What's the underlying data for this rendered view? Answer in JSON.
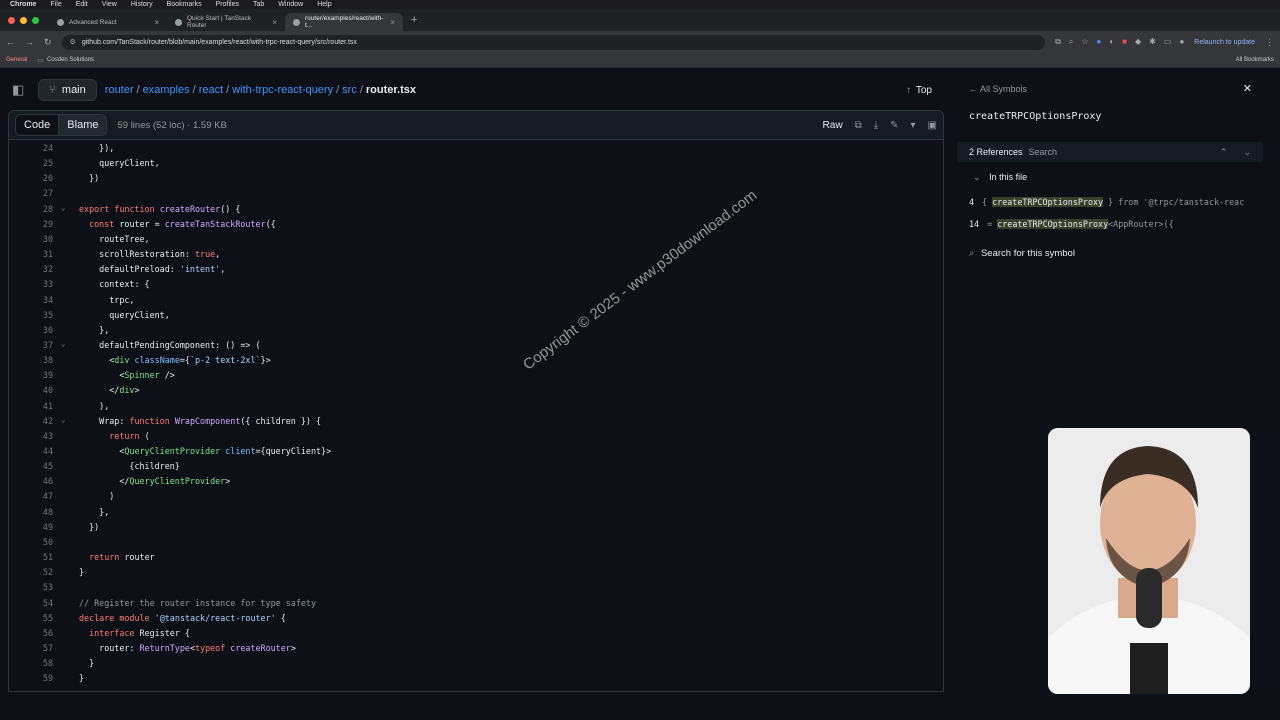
{
  "menubar": [
    "Chrome",
    "File",
    "Edit",
    "View",
    "History",
    "Bookmarks",
    "Profiles",
    "Tab",
    "Window",
    "Help"
  ],
  "tabs": [
    {
      "title": "Advanced React",
      "active": false
    },
    {
      "title": "Quick Start | TanStack Router",
      "active": false
    },
    {
      "title": "router/examples/react/with-t...",
      "active": true
    }
  ],
  "address": {
    "url": "github.com/TanStack/router/blob/main/examples/react/with-trpc-react-query/src/router.tsx",
    "relaunch": "Relaunch to update"
  },
  "bookmarks": {
    "left": [
      "General",
      "Cosden Solutions"
    ],
    "right": "All Bookmarks"
  },
  "header": {
    "branch": "main",
    "crumbs": [
      "router",
      "examples",
      "react",
      "with-trpc-react-query",
      "src"
    ],
    "file": "router.tsx",
    "top": "Top"
  },
  "filebar": {
    "code": "Code",
    "blame": "Blame",
    "meta": "59 lines (52 loc) · 1.59 KB",
    "raw": "Raw"
  },
  "code": [
    {
      "n": 24,
      "t": "    }),"
    },
    {
      "n": 25,
      "t": "    queryClient,"
    },
    {
      "n": 26,
      "t": "  })"
    },
    {
      "n": 27,
      "t": ""
    },
    {
      "n": 28,
      "t": "export function createRouter() {",
      "fold": true
    },
    {
      "n": 29,
      "t": "  const router = createTanStackRouter({"
    },
    {
      "n": 30,
      "t": "    routeTree,"
    },
    {
      "n": 31,
      "t": "    scrollRestoration: true,"
    },
    {
      "n": 32,
      "t": "    defaultPreload: 'intent',"
    },
    {
      "n": 33,
      "t": "    context: {"
    },
    {
      "n": 34,
      "t": "      trpc,"
    },
    {
      "n": 35,
      "t": "      queryClient,"
    },
    {
      "n": 36,
      "t": "    },"
    },
    {
      "n": 37,
      "t": "    defaultPendingComponent: () => (",
      "fold": true
    },
    {
      "n": 38,
      "t": "      <div className={`p-2 text-2xl`}>"
    },
    {
      "n": 39,
      "t": "        <Spinner />"
    },
    {
      "n": 40,
      "t": "      </div>"
    },
    {
      "n": 41,
      "t": "    ),"
    },
    {
      "n": 42,
      "t": "    Wrap: function WrapComponent({ children }) {",
      "fold": true
    },
    {
      "n": 43,
      "t": "      return ("
    },
    {
      "n": 44,
      "t": "        <QueryClientProvider client={queryClient}>"
    },
    {
      "n": 45,
      "t": "          {children}"
    },
    {
      "n": 46,
      "t": "        </QueryClientProvider>"
    },
    {
      "n": 47,
      "t": "      )"
    },
    {
      "n": 48,
      "t": "    },"
    },
    {
      "n": 49,
      "t": "  })"
    },
    {
      "n": 50,
      "t": ""
    },
    {
      "n": 51,
      "t": "  return router"
    },
    {
      "n": 52,
      "t": "}"
    },
    {
      "n": 53,
      "t": ""
    },
    {
      "n": 54,
      "t": "// Register the router instance for type safety"
    },
    {
      "n": 55,
      "t": "declare module '@tanstack/react-router' {"
    },
    {
      "n": 56,
      "t": "  interface Register {"
    },
    {
      "n": 57,
      "t": "    router: ReturnType<typeof createRouter>"
    },
    {
      "n": 58,
      "t": "  }"
    },
    {
      "n": 59,
      "t": "}"
    }
  ],
  "symbols": {
    "back": "All Symbols",
    "name": "createTRPCOptionsProxy",
    "refs": "2 References",
    "search": "Search",
    "in_file": "In this file",
    "items": [
      {
        "line": "4",
        "pre": "{ ",
        "hl": "createTRPCOptionsProxy",
        "post": " } from '@trpc/tanstack-reac"
      },
      {
        "line": "14",
        "pre": "= ",
        "hl": "createTRPCOptionsProxy",
        "post": "<AppRouter>({"
      }
    ],
    "search_symbol": "Search for this symbol"
  },
  "watermark": "Copyright © 2025 - www.p30download.com"
}
